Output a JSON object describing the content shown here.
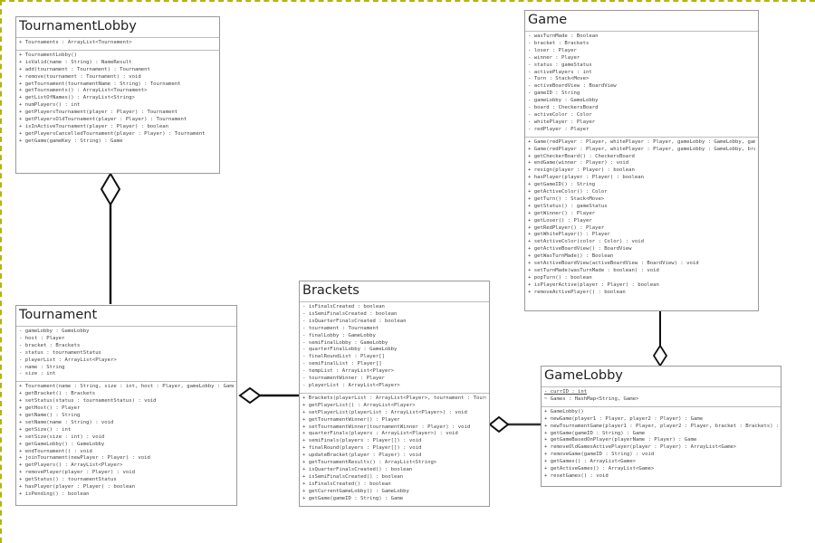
{
  "diagram": {
    "type": "UML class diagram",
    "classes": {
      "tournamentLobby": {
        "name": "TournamentLobby",
        "attributes": [
          "+ Tournaments : ArrayList<Tournament>"
        ],
        "methods": [
          "+ TournamentLobby()",
          "+ isValid(name : String) : NameResult",
          "+ add(tournament : Tournament) : Tournament",
          "+ remove(tournament : Tournament) : void",
          "+ getTournament(tournamentName : String) : Tournament",
          "+ getTournaments() : ArrayList<Tournament>",
          "+ getListOfNames() : ArrayList<String>",
          "+ numPlayers() : int",
          "+ getPlayersTournament(player : Player) : Tournament",
          "+ getPlayersOldTournament(player : Player) : Tournament",
          "+ isInActiveTournament(player : Player) : boolean",
          "+ getPlayersCancelledTournament(player : Player) : Tournament",
          "+ getGame(gameKey : String) : Game"
        ]
      },
      "tournament": {
        "name": "Tournament",
        "attributes": [
          "- gameLobby : GameLobby",
          "- host : Player",
          "- bracket : Brackets",
          "- status : tournamentStatus",
          "- playerList : ArrayList<Player>",
          "- name : String",
          "- size : int"
        ],
        "methods": [
          "+ Tournament(name : String, size : int, host : Player, gameLobby : GameLobby)",
          "+ getBracket() : Brackets",
          "+ setStatus(status : tournamentStatus) : void",
          "+ getHost() : Player",
          "+ getName() : String",
          "+ setName(name : String) : void",
          "+ getSize() : int",
          "+ setSize(size : int) : void",
          "+ getGameLobby() : GameLobby",
          "+ endTournament() : void",
          "+ joinTournament(newPlayer : Player) : void",
          "+ getPlayers() : ArrayList<Player>",
          "+ removePlayer(player : Player) : void",
          "+ getStatus() : tournamentStatus",
          "+ hasPlayer(player : Player) : boolean",
          "+ isPending() : boolean"
        ]
      },
      "brackets": {
        "name": "Brackets",
        "attributes": [
          "- isFinalsCreated : boolean",
          "- isSemiFinalsCreated : boolean",
          "- isQuarterFinalsCreated : boolean",
          "- tournament : Tournament",
          "- finalLobby : GameLobby",
          "- semiFinalLobby : GameLobby",
          "- quarterFinalLobby : GameLobby",
          "- finalRoundList : Player[]",
          "- semiFinalList : Player[]",
          "- tempList : ArrayList<Player>",
          "- tournamentWinner : Player",
          "- playerList : ArrayList<Player>"
        ],
        "methods": [
          "+ Brackets(playerList : ArrayList<Player>, tournament : Tournament)",
          "+ getPlayerList() : ArrayList<Player>",
          "+ setPlayerList(playerList : ArrayList<Player>) : void",
          "+ getTournamentWinner() : Player",
          "+ setTournamentWinner(tournamentWinner : Player) : void",
          "+ quarterFinals(players : ArrayList<Player>) : void",
          "+ semiFinals(players : Player[]) : void",
          "+ finalRound(players : Player[]) : void",
          "+ updateBracket(player : Player) : void",
          "+ getTournamentResults() : ArrayList<String>",
          "+ isQuarterFinalsCreated() : boolean",
          "+ isSemiFinalsCreated() : boolean",
          "+ isFinalsCreated() : boolean",
          "+ getCurrentGameLobby() : GameLobby",
          "+ getGame(gameID : String) : Game"
        ]
      },
      "game": {
        "name": "Game",
        "attributes": [
          "- wasTurnMade : Boolean",
          "- bracket : Brackets",
          "- loser : Player",
          "- winner : Player",
          "- status : gameStatus",
          "- activePlayers : int",
          "- Turn : Stack<Move>",
          "- activeBoardView : BoardView",
          "- gameID : String",
          "- gameLobby : GameLobby",
          "- board : CheckersBoard",
          "- activeColor : Color",
          "- whitePlayer : Player",
          "- redPlayer : Player"
        ],
        "methods": [
          "+ Game(redPlayer : Player, whitePlayer : Player, gameLobby : GameLobby, gameID : int)",
          "+ Game(redPlayer : Player, whitePlayer : Player, gameLobby : GameLobby, bracket : Brackets)",
          "+ getCheckerBoard() : CheckersBoard",
          "+ endGame(winner : Player) : void",
          "+ resign(player : Player) : boolean",
          "+ hasPlayer(player : Player) : boolean",
          "+ getGameID() : String",
          "+ getActiveColor() : Color",
          "+ getTurn() : Stack<Move>",
          "+ getStatus() : gameStatus",
          "+ getWinner() : Player",
          "+ getLoser() : Player",
          "+ getRedPlayer() : Player",
          "+ getWhitePlayer() : Player",
          "+ setActiveColor(color : Color) : void",
          "+ getActiveBoardView() : BoardView",
          "+ getWasTurnMade() : Boolean",
          "+ setActiveBoardView(activeBoardView : BoardView) : void",
          "+ setTurnMade(wasTurnMade : boolean) : void",
          "+ popTurn() : boolean",
          "+ isPlayerActive(player : Player) : boolean",
          "+ removeActivePlayer() : boolean"
        ]
      },
      "gameLobby": {
        "name": "GameLobby",
        "attributes": [
          "- currID : int",
          "~ Games : HashMap<String, Game>"
        ],
        "static_attribute_index": 0,
        "methods": [
          "+ GameLobby()",
          "+ newGame(player1 : Player, player2 : Player) : Game",
          "+ newTournamentGame(player1 : Player, player2 : Player, bracket : Brackets) : Game",
          "+ getGame(gameID : String) : Game",
          "+ getGameBasedOnPlayer(playerName : Player) : Game",
          "+ removeOldGamesActivePlayer(player : Player) : ArrayList<Game>",
          "+ removeGame(gameID : String) : void",
          "+ getGames() : ArrayList<Game>",
          "+ getActiveGames() : ArrayList<Game>",
          "+ resetGames() : void"
        ]
      }
    },
    "relationships": [
      {
        "type": "aggregation",
        "whole": "TournamentLobby",
        "part": "Tournament"
      },
      {
        "type": "aggregation",
        "whole": "Tournament",
        "part": "Brackets"
      },
      {
        "type": "aggregation",
        "whole": "Brackets",
        "part": "GameLobby"
      },
      {
        "type": "aggregation",
        "whole": "GameLobby",
        "part": "Game"
      }
    ]
  }
}
